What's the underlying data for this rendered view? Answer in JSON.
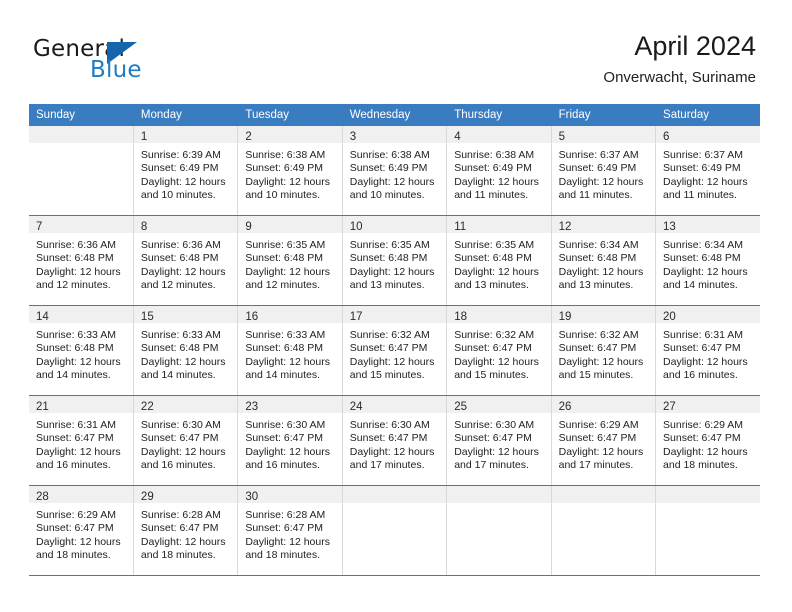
{
  "logo": {
    "word_general": "General",
    "word_blue": "Blue",
    "accent_color": "#1e7bc4",
    "triangle_color": "#1565ad"
  },
  "header": {
    "title": "April 2024",
    "subtitle": "Onverwacht, Suriname",
    "header_bg": "#3a7cc0"
  },
  "weekdays": [
    "Sunday",
    "Monday",
    "Tuesday",
    "Wednesday",
    "Thursday",
    "Friday",
    "Saturday"
  ],
  "weeks": [
    [
      {
        "day": "",
        "lines": []
      },
      {
        "day": "1",
        "lines": [
          "Sunrise: 6:39 AM",
          "Sunset: 6:49 PM",
          "Daylight: 12 hours",
          "and 10 minutes."
        ]
      },
      {
        "day": "2",
        "lines": [
          "Sunrise: 6:38 AM",
          "Sunset: 6:49 PM",
          "Daylight: 12 hours",
          "and 10 minutes."
        ]
      },
      {
        "day": "3",
        "lines": [
          "Sunrise: 6:38 AM",
          "Sunset: 6:49 PM",
          "Daylight: 12 hours",
          "and 10 minutes."
        ]
      },
      {
        "day": "4",
        "lines": [
          "Sunrise: 6:38 AM",
          "Sunset: 6:49 PM",
          "Daylight: 12 hours",
          "and 11 minutes."
        ]
      },
      {
        "day": "5",
        "lines": [
          "Sunrise: 6:37 AM",
          "Sunset: 6:49 PM",
          "Daylight: 12 hours",
          "and 11 minutes."
        ]
      },
      {
        "day": "6",
        "lines": [
          "Sunrise: 6:37 AM",
          "Sunset: 6:49 PM",
          "Daylight: 12 hours",
          "and 11 minutes."
        ]
      }
    ],
    [
      {
        "day": "7",
        "lines": [
          "Sunrise: 6:36 AM",
          "Sunset: 6:48 PM",
          "Daylight: 12 hours",
          "and 12 minutes."
        ]
      },
      {
        "day": "8",
        "lines": [
          "Sunrise: 6:36 AM",
          "Sunset: 6:48 PM",
          "Daylight: 12 hours",
          "and 12 minutes."
        ]
      },
      {
        "day": "9",
        "lines": [
          "Sunrise: 6:35 AM",
          "Sunset: 6:48 PM",
          "Daylight: 12 hours",
          "and 12 minutes."
        ]
      },
      {
        "day": "10",
        "lines": [
          "Sunrise: 6:35 AM",
          "Sunset: 6:48 PM",
          "Daylight: 12 hours",
          "and 13 minutes."
        ]
      },
      {
        "day": "11",
        "lines": [
          "Sunrise: 6:35 AM",
          "Sunset: 6:48 PM",
          "Daylight: 12 hours",
          "and 13 minutes."
        ]
      },
      {
        "day": "12",
        "lines": [
          "Sunrise: 6:34 AM",
          "Sunset: 6:48 PM",
          "Daylight: 12 hours",
          "and 13 minutes."
        ]
      },
      {
        "day": "13",
        "lines": [
          "Sunrise: 6:34 AM",
          "Sunset: 6:48 PM",
          "Daylight: 12 hours",
          "and 14 minutes."
        ]
      }
    ],
    [
      {
        "day": "14",
        "lines": [
          "Sunrise: 6:33 AM",
          "Sunset: 6:48 PM",
          "Daylight: 12 hours",
          "and 14 minutes."
        ]
      },
      {
        "day": "15",
        "lines": [
          "Sunrise: 6:33 AM",
          "Sunset: 6:48 PM",
          "Daylight: 12 hours",
          "and 14 minutes."
        ]
      },
      {
        "day": "16",
        "lines": [
          "Sunrise: 6:33 AM",
          "Sunset: 6:48 PM",
          "Daylight: 12 hours",
          "and 14 minutes."
        ]
      },
      {
        "day": "17",
        "lines": [
          "Sunrise: 6:32 AM",
          "Sunset: 6:47 PM",
          "Daylight: 12 hours",
          "and 15 minutes."
        ]
      },
      {
        "day": "18",
        "lines": [
          "Sunrise: 6:32 AM",
          "Sunset: 6:47 PM",
          "Daylight: 12 hours",
          "and 15 minutes."
        ]
      },
      {
        "day": "19",
        "lines": [
          "Sunrise: 6:32 AM",
          "Sunset: 6:47 PM",
          "Daylight: 12 hours",
          "and 15 minutes."
        ]
      },
      {
        "day": "20",
        "lines": [
          "Sunrise: 6:31 AM",
          "Sunset: 6:47 PM",
          "Daylight: 12 hours",
          "and 16 minutes."
        ]
      }
    ],
    [
      {
        "day": "21",
        "lines": [
          "Sunrise: 6:31 AM",
          "Sunset: 6:47 PM",
          "Daylight: 12 hours",
          "and 16 minutes."
        ]
      },
      {
        "day": "22",
        "lines": [
          "Sunrise: 6:30 AM",
          "Sunset: 6:47 PM",
          "Daylight: 12 hours",
          "and 16 minutes."
        ]
      },
      {
        "day": "23",
        "lines": [
          "Sunrise: 6:30 AM",
          "Sunset: 6:47 PM",
          "Daylight: 12 hours",
          "and 16 minutes."
        ]
      },
      {
        "day": "24",
        "lines": [
          "Sunrise: 6:30 AM",
          "Sunset: 6:47 PM",
          "Daylight: 12 hours",
          "and 17 minutes."
        ]
      },
      {
        "day": "25",
        "lines": [
          "Sunrise: 6:30 AM",
          "Sunset: 6:47 PM",
          "Daylight: 12 hours",
          "and 17 minutes."
        ]
      },
      {
        "day": "26",
        "lines": [
          "Sunrise: 6:29 AM",
          "Sunset: 6:47 PM",
          "Daylight: 12 hours",
          "and 17 minutes."
        ]
      },
      {
        "day": "27",
        "lines": [
          "Sunrise: 6:29 AM",
          "Sunset: 6:47 PM",
          "Daylight: 12 hours",
          "and 18 minutes."
        ]
      }
    ],
    [
      {
        "day": "28",
        "lines": [
          "Sunrise: 6:29 AM",
          "Sunset: 6:47 PM",
          "Daylight: 12 hours",
          "and 18 minutes."
        ]
      },
      {
        "day": "29",
        "lines": [
          "Sunrise: 6:28 AM",
          "Sunset: 6:47 PM",
          "Daylight: 12 hours",
          "and 18 minutes."
        ]
      },
      {
        "day": "30",
        "lines": [
          "Sunrise: 6:28 AM",
          "Sunset: 6:47 PM",
          "Daylight: 12 hours",
          "and 18 minutes."
        ]
      },
      {
        "day": "",
        "lines": []
      },
      {
        "day": "",
        "lines": []
      },
      {
        "day": "",
        "lines": []
      },
      {
        "day": "",
        "lines": []
      }
    ]
  ]
}
